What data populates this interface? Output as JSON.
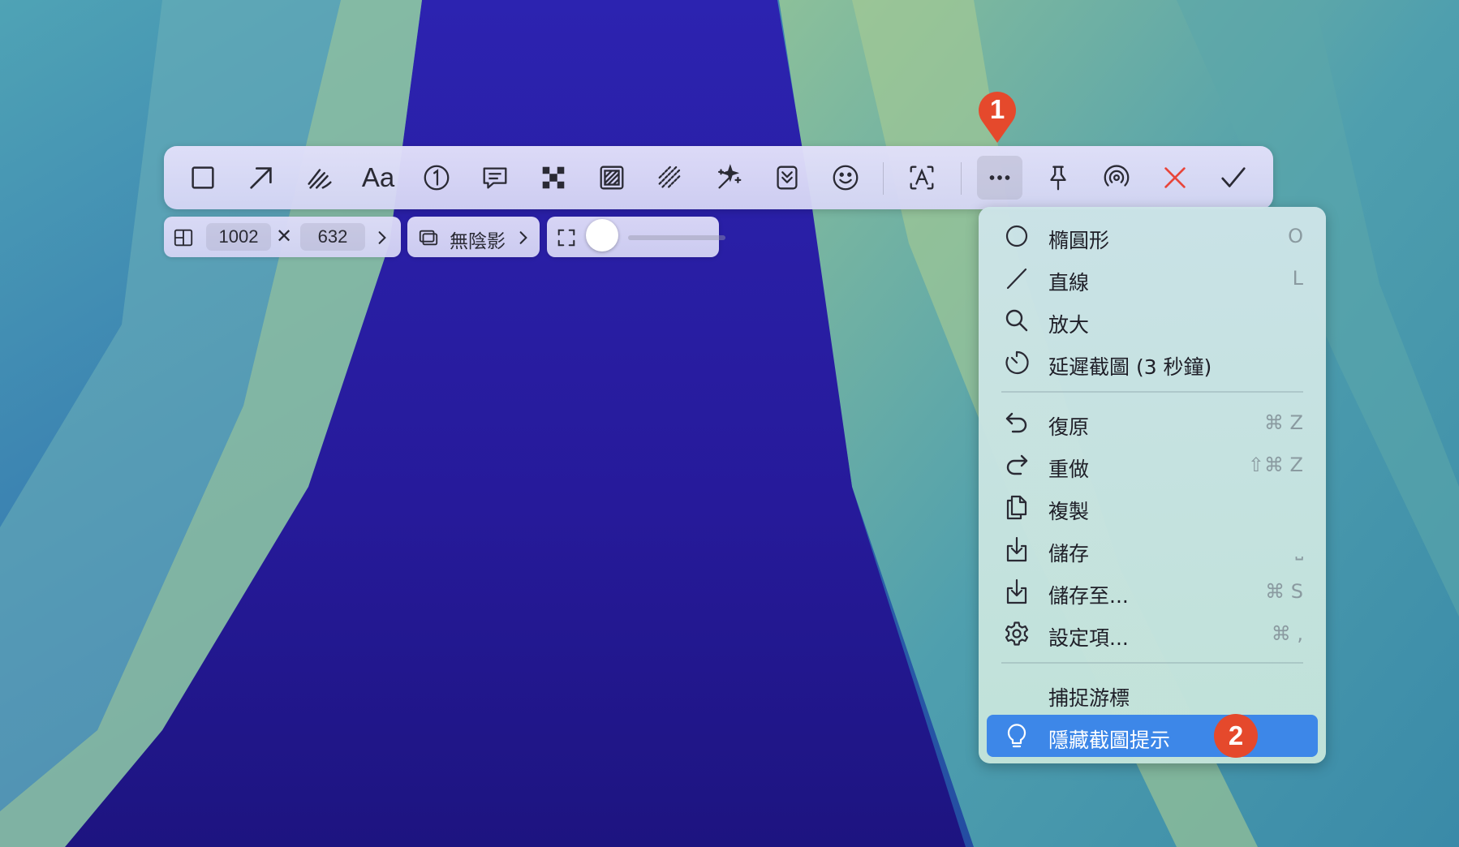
{
  "colors": {
    "accent": "#3d87e8",
    "badge": "#e5492c",
    "close": "#e8453a",
    "toolbar_bg": "#dcdaf8",
    "menu_bg": "#c8e4e0"
  },
  "toolbar": {
    "tools": [
      {
        "name": "rectangle-tool-button",
        "icon": "rectangle-icon"
      },
      {
        "name": "arrow-tool-button",
        "icon": "arrow-icon"
      },
      {
        "name": "pen-tool-button",
        "icon": "pen-icon"
      },
      {
        "name": "text-tool-button",
        "icon": "text-icon",
        "label": "Aa"
      },
      {
        "name": "counter-tool-button",
        "icon": "number-circle-icon"
      },
      {
        "name": "speech-bubble-tool-button",
        "icon": "speech-bubble-icon"
      },
      {
        "name": "pixelate-tool-button",
        "icon": "pixelate-icon"
      },
      {
        "name": "blur-tool-button",
        "icon": "blur-icon"
      },
      {
        "name": "hatch-tool-button",
        "icon": "hatch-icon"
      },
      {
        "name": "magic-tool-button",
        "icon": "sparkles-icon"
      },
      {
        "name": "scroll-capture-button",
        "icon": "scroll-down-icon"
      },
      {
        "name": "emoji-tool-button",
        "icon": "emoji-icon"
      },
      {
        "name": "ocr-text-button",
        "icon": "text-recognition-icon"
      },
      {
        "name": "more-button",
        "icon": "ellipsis-icon",
        "active": true
      },
      {
        "name": "pin-button",
        "icon": "pin-icon"
      },
      {
        "name": "share-button",
        "icon": "airdrop-icon"
      },
      {
        "name": "close-button",
        "icon": "close-icon"
      },
      {
        "name": "confirm-button",
        "icon": "checkmark-icon"
      }
    ]
  },
  "subbar": {
    "width_value": "1002",
    "times_symbol": "✕",
    "height_value": "632",
    "shadow_label": "無陰影",
    "padding_level": 0
  },
  "badges": {
    "first": "1",
    "second": "2"
  },
  "menu": {
    "items": [
      {
        "icon": "circle-icon",
        "label": "橢圓形",
        "shortcut": "O"
      },
      {
        "icon": "line-icon",
        "label": "直線",
        "shortcut": "L"
      },
      {
        "icon": "magnifier-icon",
        "label": "放大",
        "shortcut": ""
      },
      {
        "icon": "timer-icon",
        "label": "延遲截圖 (3 秒鐘)",
        "shortcut": ""
      },
      {
        "icon": "undo-icon",
        "label": "復原",
        "shortcut": "⌘ Z"
      },
      {
        "icon": "redo-icon",
        "label": "重做",
        "shortcut": "⇧⌘ Z"
      },
      {
        "icon": "copy-icon",
        "label": "複製",
        "shortcut": ""
      },
      {
        "icon": "save-icon",
        "label": "儲存",
        "shortcut": "⎵"
      },
      {
        "icon": "save-as-icon",
        "label": "儲存至...",
        "shortcut": "⌘ S"
      },
      {
        "icon": "gear-icon",
        "label": "設定項...",
        "shortcut": "⌘ ,"
      },
      {
        "icon": "",
        "label": "捕捉游標",
        "shortcut": ""
      },
      {
        "icon": "lightbulb-icon",
        "label": "隱藏截圖提示",
        "shortcut": "",
        "selected": true
      }
    ]
  }
}
